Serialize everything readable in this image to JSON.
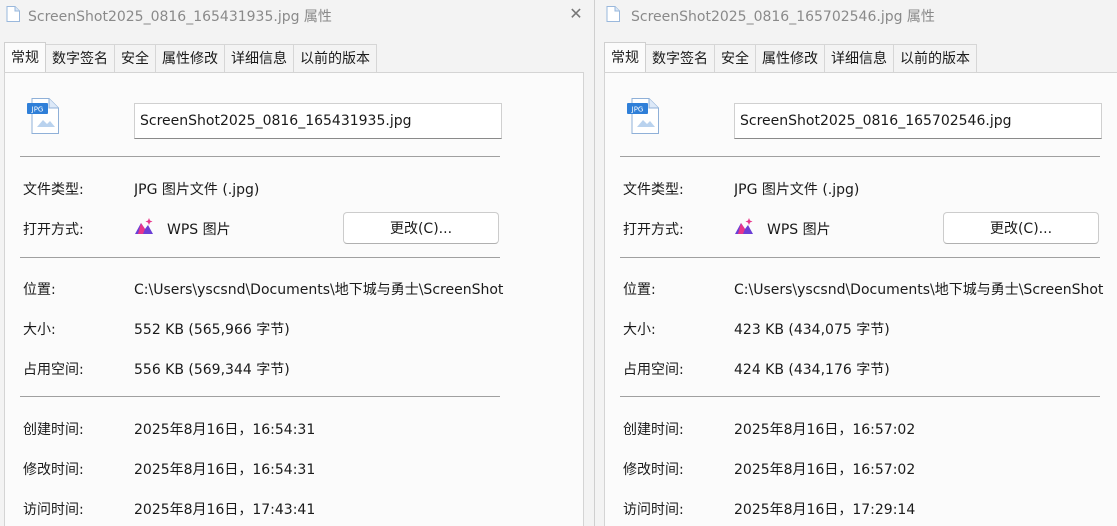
{
  "windows": [
    {
      "title": "ScreenShot2025_0816_165431935.jpg 属性",
      "tabs": [
        "常规",
        "数字签名",
        "安全",
        "属性修改",
        "详细信息",
        "以前的版本"
      ],
      "file_name": "ScreenShot2025_0816_165431935.jpg",
      "file_icon_label": "JPG",
      "file_type_label": "文件类型:",
      "file_type": "JPG 图片文件 (.jpg)",
      "open_with_label": "打开方式:",
      "open_with_app": "WPS 图片",
      "change_button": "更改(C)...",
      "location_label": "位置:",
      "location": "C:\\Users\\yscsnd\\Documents\\地下城与勇士\\ScreenShot",
      "size_label": "大小:",
      "size": "552 KB (565,966 字节)",
      "disk_size_label": "占用空间:",
      "disk_size": "556 KB (569,344 字节)",
      "created_label": "创建时间:",
      "created": "2025年8月16日，16:54:31",
      "modified_label": "修改时间:",
      "modified": "2025年8月16日，16:54:31",
      "accessed_label": "访问时间:",
      "accessed": "2025年8月16日，17:43:41"
    },
    {
      "title": "ScreenShot2025_0816_165702546.jpg 属性",
      "tabs": [
        "常规",
        "数字签名",
        "安全",
        "属性修改",
        "详细信息",
        "以前的版本"
      ],
      "file_name": "ScreenShot2025_0816_165702546.jpg",
      "file_icon_label": "JPG",
      "file_type_label": "文件类型:",
      "file_type": "JPG 图片文件 (.jpg)",
      "open_with_label": "打开方式:",
      "open_with_app": "WPS 图片",
      "change_button": "更改(C)...",
      "location_label": "位置:",
      "location": "C:\\Users\\yscsnd\\Documents\\地下城与勇士\\ScreenShot",
      "size_label": "大小:",
      "size": "423 KB (434,075 字节)",
      "disk_size_label": "占用空间:",
      "disk_size": "424 KB (434,176 字节)",
      "created_label": "创建时间:",
      "created": "2025年8月16日，16:57:02",
      "modified_label": "修改时间:",
      "modified": "2025年8月16日，16:57:02",
      "accessed_label": "访问时间:",
      "accessed": "2025年8月16日，17:29:14"
    }
  ],
  "colors": {
    "icon_blue": "#2f7fd8",
    "wps_pink": "#e8358a",
    "wps_purple": "#6b3fd6"
  }
}
